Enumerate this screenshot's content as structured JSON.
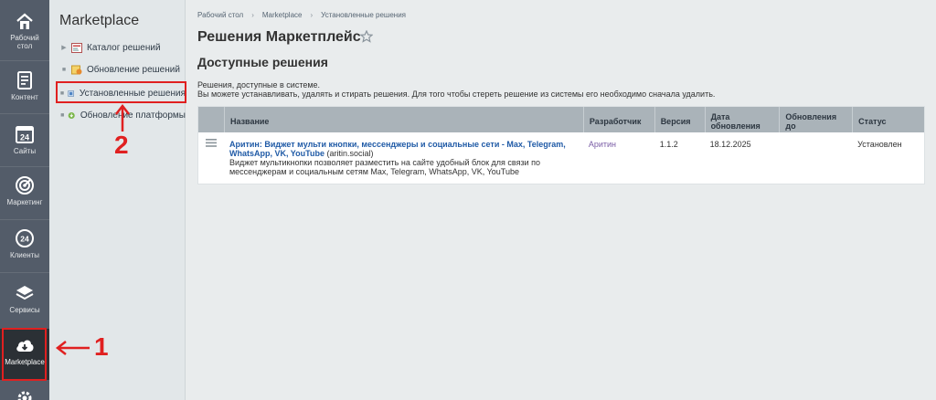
{
  "rail": {
    "items": [
      {
        "label_lines": [
          "Рабочий",
          "стол"
        ],
        "icon": "home-icon"
      },
      {
        "label_lines": [
          "Контент"
        ],
        "icon": "document-icon"
      },
      {
        "label_lines": [
          "Сайты"
        ],
        "icon": "calendar-24-icon",
        "badge": "24"
      },
      {
        "label_lines": [
          "Маркетинг"
        ],
        "icon": "target-icon"
      },
      {
        "label_lines": [
          "Клиенты"
        ],
        "icon": "clients-24-icon",
        "badge": "24"
      },
      {
        "label_lines": [
          "Сервисы"
        ],
        "icon": "layers-icon"
      },
      {
        "label_lines": [
          "Marketplace"
        ],
        "icon": "cloud-download-icon",
        "active": true
      }
    ]
  },
  "menu": {
    "title": "Marketplace",
    "items": [
      {
        "label": "Каталог решений",
        "icon": "catalog-icon",
        "marker": "▶"
      },
      {
        "label": "Обновление решений",
        "icon": "update-solutions-icon",
        "marker": "■"
      },
      {
        "label": "Установленные решения",
        "icon": "installed-solutions-icon",
        "marker": "■"
      },
      {
        "label": "Обновление платформы",
        "icon": "platform-update-icon",
        "marker": "■"
      }
    ]
  },
  "breadcrumb": [
    "Рабочий стол",
    "Marketplace",
    "Установленные решения"
  ],
  "page_title": "Решения Маркетплейс",
  "section_title": "Доступные решения",
  "description": {
    "line1": "Решения, доступные в системе.",
    "line2": "Вы можете устанавливать, удалять и стирать решения. Для того чтобы стереть решение из системы его необходимо сначала удалить."
  },
  "table": {
    "headers": {
      "name": "Название",
      "developer": "Разработчик",
      "version": "Версия",
      "date_line1": "Дата",
      "date_line2": "обновления",
      "updates_line1": "Обновления",
      "updates_line2": "до",
      "status": "Статус"
    },
    "rows": [
      {
        "title": "Аритин: Виджет мульти кнопки, мессенджеры и социальные сети - Max, Telegram, WhatsApp, VK, YouTube",
        "code": "(aritin.social)",
        "description": "Виджет мультикнопки позволяет разместить на сайте удобный блок для связи по мессенджерам и социальным сетям Max, Telegram, WhatsApp, VK, YouTube",
        "developer": "Аритин",
        "version": "1.1.2",
        "date": "18.12.2025",
        "updates_until": "",
        "status": "Установлен"
      }
    ]
  },
  "annotations": {
    "step1": "1",
    "step2": "2",
    "color": "#e02020"
  }
}
